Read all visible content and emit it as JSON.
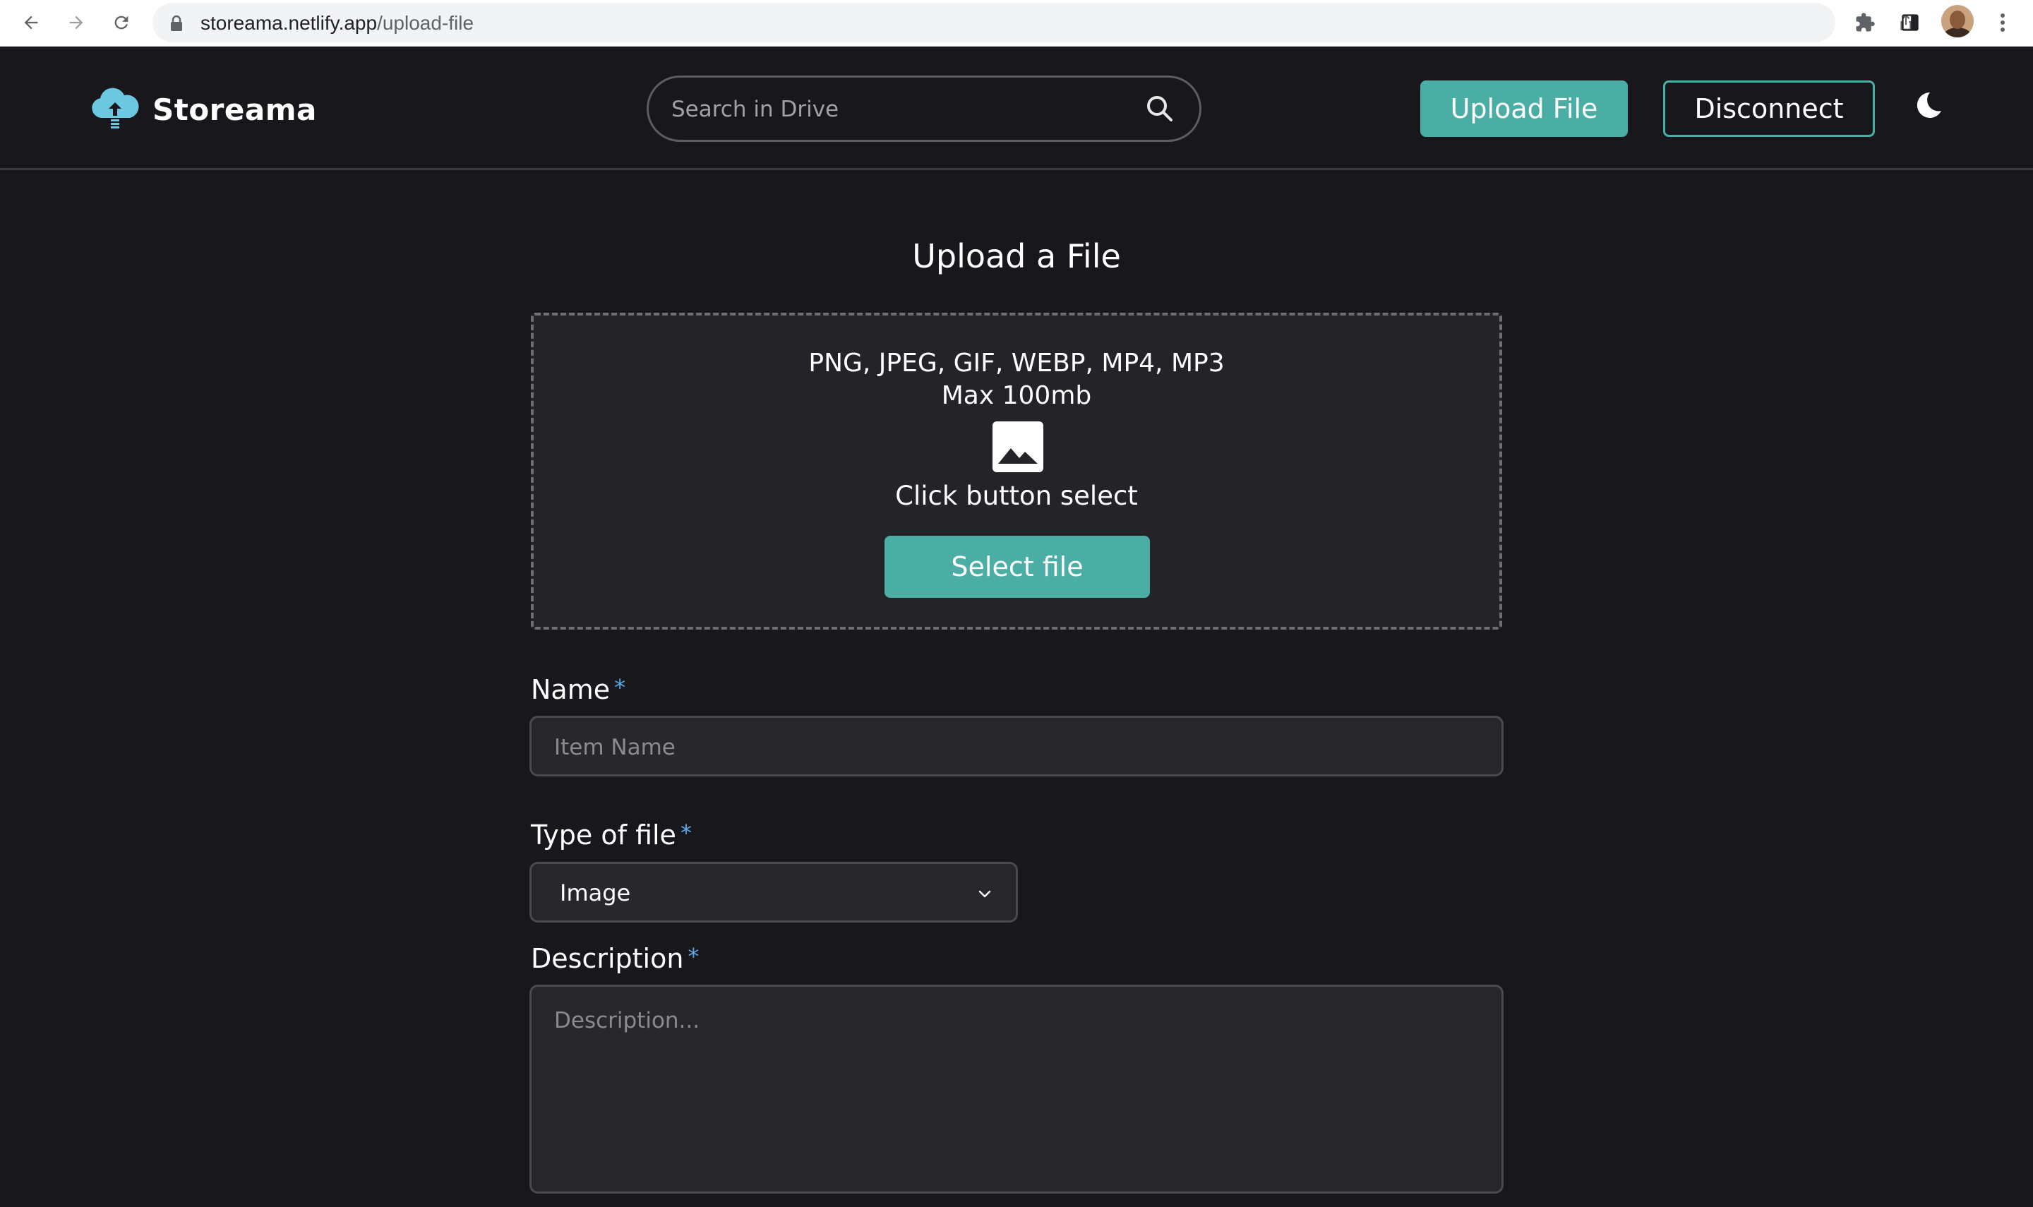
{
  "browser": {
    "url_host": "storeama.netlify.app",
    "url_path": "/upload-file"
  },
  "header": {
    "brand": "Storeama",
    "search_placeholder": "Search in Drive",
    "upload_button": "Upload File",
    "disconnect_button": "Disconnect"
  },
  "main": {
    "title": "Upload a File",
    "dropzone": {
      "formats": "PNG, JPEG, GIF, WEBP, MP4, MP3",
      "max_size": "Max 100mb",
      "hint": "Click button select",
      "select_button": "Select file"
    },
    "form": {
      "name_label": "Name",
      "name_placeholder": "Item Name",
      "type_label": "Type of file",
      "type_value": "Image",
      "description_label": "Description",
      "description_placeholder": "Description...",
      "required_mark": "*"
    }
  },
  "colors": {
    "background": "#18181c",
    "accent": "#4aaea5",
    "required": "#5aa9e6"
  }
}
